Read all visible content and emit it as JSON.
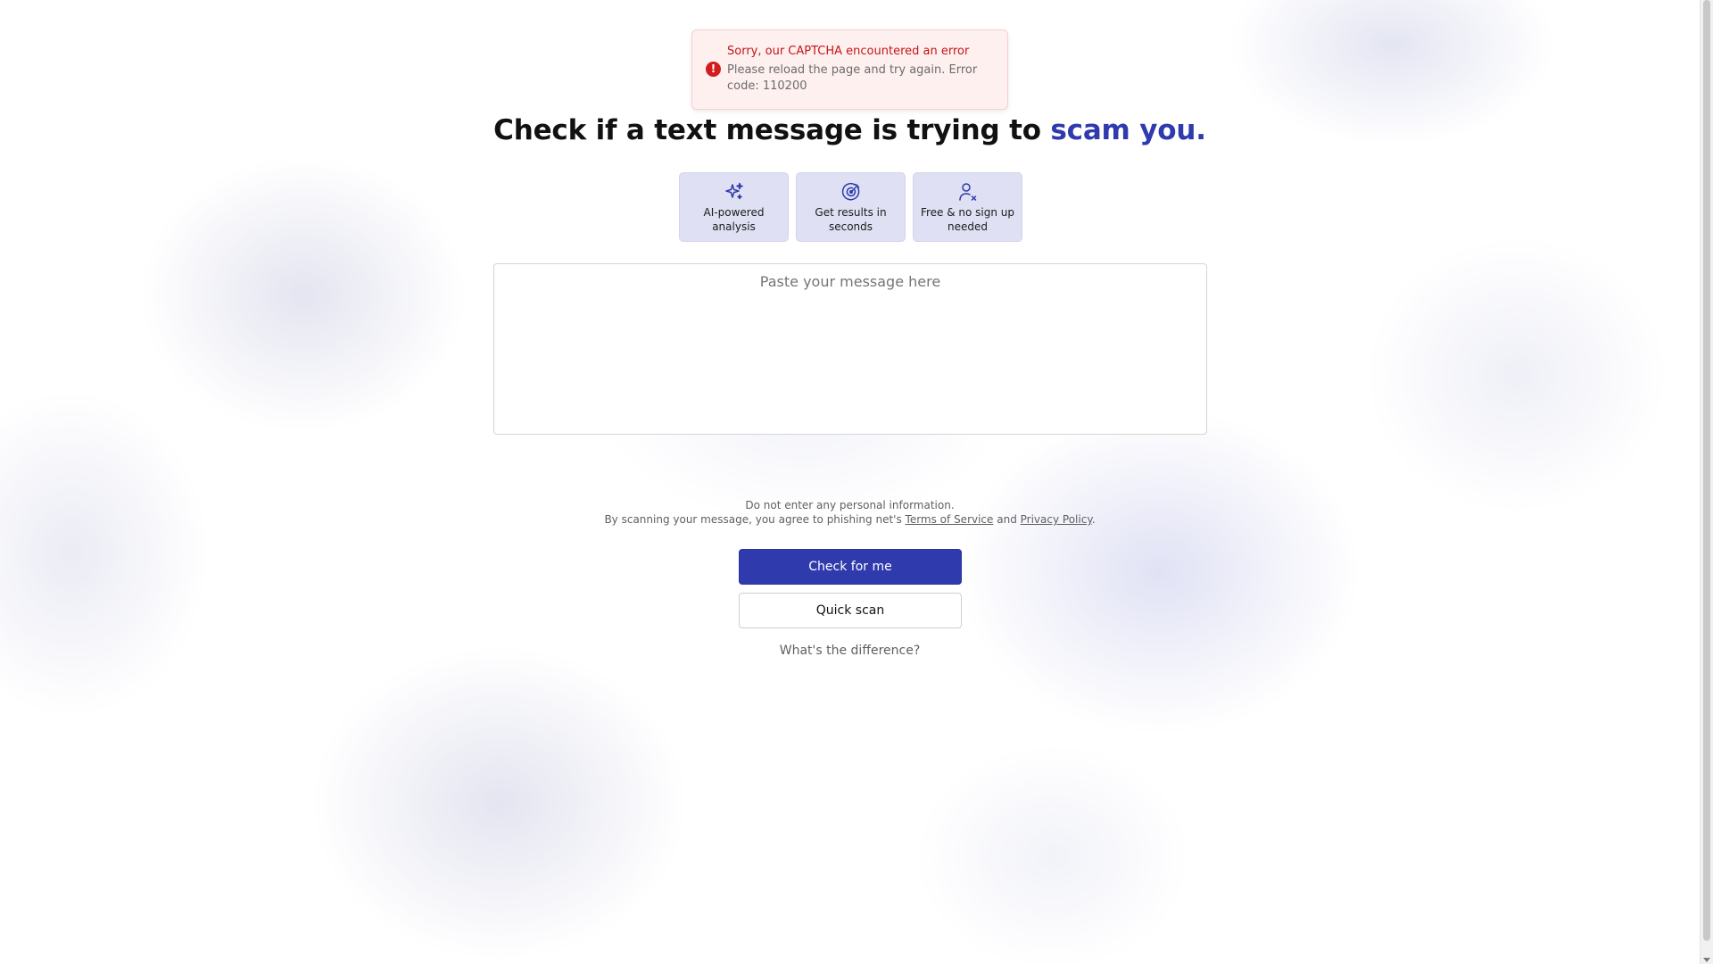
{
  "toast": {
    "title": "Sorry, our CAPTCHA encountered an error",
    "description": "Please reload the page and try again. Error code: 110200",
    "icon": "exclamation-icon"
  },
  "headline": {
    "main": "Check if a text message is trying to ",
    "accent": "scam you."
  },
  "features": [
    {
      "label": "AI-powered analysis",
      "icon": "sparkles-icon"
    },
    {
      "label": "Get results in seconds",
      "icon": "target-icon"
    },
    {
      "label": "Free & no sign up needed",
      "icon": "user-x-icon"
    }
  ],
  "message": {
    "placeholder": "Paste your message here",
    "value": ""
  },
  "notice": {
    "line1": "Do not enter any personal information.",
    "line2_prefix": "By scanning your message, you agree to phishing net's ",
    "terms_link": "Terms of Service",
    "and_text": " and ",
    "privacy_link": "Privacy Policy",
    "suffix": "."
  },
  "buttons": {
    "primary": "Check for me",
    "secondary": "Quick scan"
  },
  "difference_link": "What's the difference?",
  "colors": {
    "accent": "#2e3aad",
    "error": "#c41414",
    "feature_bg": "#dfe0f3"
  }
}
